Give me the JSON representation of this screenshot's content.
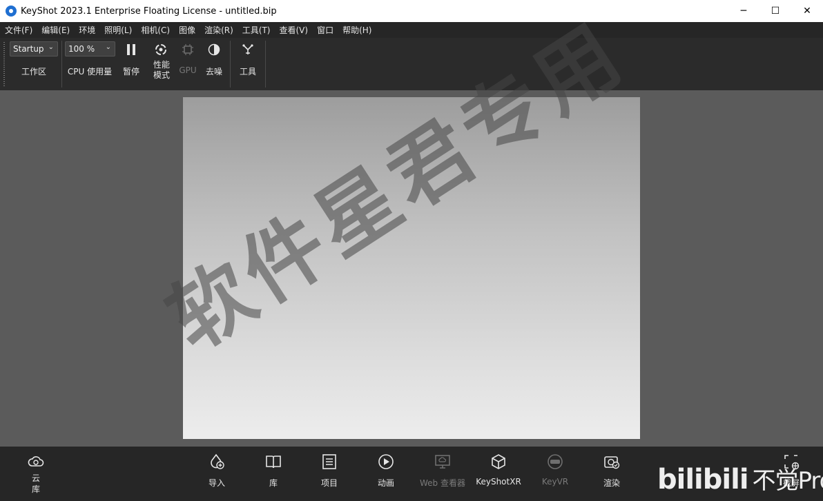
{
  "window": {
    "title": "KeyShot 2023.1 Enterprise Floating License  - untitled.bip",
    "minimize": "─",
    "maximize": "☐",
    "close": "✕"
  },
  "menu": [
    "文件(F)",
    "编辑(E)",
    "环境",
    "照明(L)",
    "相机(C)",
    "图像",
    "渲染(R)",
    "工具(T)",
    "查看(V)",
    "窗口",
    "帮助(H)"
  ],
  "toolbar": {
    "workspace_value": "Startup",
    "workspace_label": "工作区",
    "cpu_value": "100 %",
    "cpu_label": "CPU 使用量",
    "pause_label": "暂停",
    "perf_label_1": "性能",
    "perf_label_2": "模式",
    "gpu_label": "GPU",
    "denoise_label": "去噪",
    "tools_label": "工具"
  },
  "watermark": "软件星君专用",
  "bottom": {
    "cloud_1": "云",
    "cloud_2": "库",
    "items": [
      {
        "label": "导入",
        "icon": "import-icon"
      },
      {
        "label": "库",
        "icon": "library-icon"
      },
      {
        "label": "项目",
        "icon": "project-icon"
      },
      {
        "label": "动画",
        "icon": "animation-icon"
      },
      {
        "label": "Web 查看器",
        "icon": "web-viewer-icon",
        "disabled": true
      },
      {
        "label": "KeyShotXR",
        "icon": "keyshotxr-icon"
      },
      {
        "label": "KeyVR",
        "icon": "keyvr-icon",
        "disabled": true
      },
      {
        "label": "渲染",
        "icon": "render-icon"
      }
    ],
    "screenshot": "截屏"
  },
  "overlay": {
    "brand": "bilibili",
    "brand_sub": "不觉Pro"
  },
  "colors": {
    "menubar": "#262626",
    "toolbar": "#2b2b2b",
    "viewport": "#5b5b5b",
    "accent": "#1f6fd1"
  }
}
